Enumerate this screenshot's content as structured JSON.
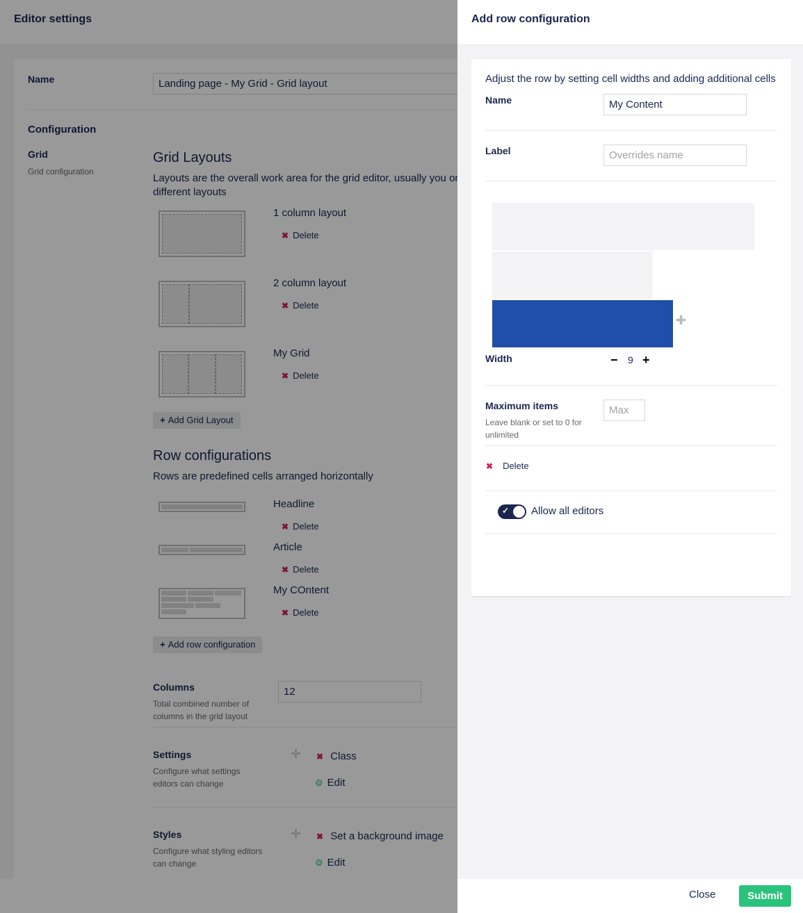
{
  "editor": {
    "title": "Editor settings",
    "name_label": "Name",
    "name_value": "Landing page - My Grid - Grid layout",
    "configuration_label": "Configuration",
    "grid_label": "Grid",
    "grid_desc": "Grid configuration",
    "grid_layouts": {
      "heading": "Grid Layouts",
      "desc_line1": "Layouts are the overall work area for the grid editor, usually you on",
      "desc_line2": "different layouts",
      "items": [
        {
          "name": "1 column layout",
          "delete": "Delete"
        },
        {
          "name": "2 column layout",
          "delete": "Delete"
        },
        {
          "name": "My Grid",
          "delete": "Delete"
        }
      ],
      "add_button": "Add Grid Layout"
    },
    "row_configurations": {
      "heading": "Row configurations",
      "desc": "Rows are predefined cells arranged horizontally",
      "items": [
        {
          "name": "Headline",
          "delete": "Delete"
        },
        {
          "name": "Article",
          "delete": "Delete"
        },
        {
          "name": "My COntent",
          "delete": "Delete"
        }
      ],
      "add_button": "Add row configuration"
    },
    "columns": {
      "label": "Columns",
      "desc_line1": "Total combined number of",
      "desc_line2": "columns in the grid layout",
      "value": "12"
    },
    "settings": {
      "label": "Settings",
      "desc_line1": "Configure what settings",
      "desc_line2": "editors can change",
      "item": "Class",
      "edit": "Edit"
    },
    "styles": {
      "label": "Styles",
      "desc_line1": "Configure what styling editors",
      "desc_line2": "can change",
      "item": "Set a background image",
      "edit": "Edit"
    }
  },
  "dialog": {
    "title": "Add row configuration",
    "intro": "Adjust the row by setting cell widths and adding additional cells",
    "name_label": "Name",
    "name_value": "My Content",
    "label_label": "Label",
    "label_placeholder": "Overrides name",
    "width_label": "Width",
    "width_value": "9",
    "cell_widths": [
      12,
      7.35,
      8.27
    ],
    "max_items_label": "Maximum items",
    "max_items_desc_line1": "Leave blank or set to 0 for",
    "max_items_desc_line2": "unlimited",
    "max_placeholder": "Max",
    "delete_label": "Delete",
    "allow_all_label": "Allow all editors",
    "allow_all_on": true,
    "close_label": "Close",
    "submit_label": "Submit"
  },
  "colors": {
    "accent": "#1f4fa8",
    "submit": "#2bc37c",
    "danger": "#d42054",
    "text": "#1b264f"
  }
}
